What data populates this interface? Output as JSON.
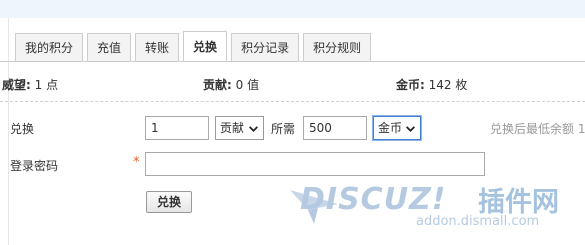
{
  "tabs": [
    {
      "label": "我的积分",
      "active": false
    },
    {
      "label": "充值",
      "active": false
    },
    {
      "label": "转账",
      "active": false
    },
    {
      "label": "兑换",
      "active": true
    },
    {
      "label": "积分记录",
      "active": false
    },
    {
      "label": "积分规则",
      "active": false
    }
  ],
  "stats": {
    "prestige_label": "威望:",
    "prestige_value": "1 点",
    "contribution_label": "贡献:",
    "contribution_value": "0 值",
    "gold_label": "金币:",
    "gold_value": "142 枚"
  },
  "exchange": {
    "row_label": "兑换",
    "amount_value": "1",
    "from_currency": "贡献",
    "need_label": "所需",
    "need_value": "500",
    "to_currency": "金币",
    "min_note": "兑换后最低余额 1"
  },
  "password": {
    "label": "登录密码",
    "required_mark": "*",
    "value": ""
  },
  "submit_label": "兑换",
  "watermark": {
    "logo_text": "DISCUZ!",
    "cn_text": "插件网",
    "url_text": "addon.dismall.com"
  },
  "colors": {
    "accent_blue": "#3c7fd1",
    "required_red": "#e25f2c",
    "tab_bg": "#f3f3f3"
  }
}
